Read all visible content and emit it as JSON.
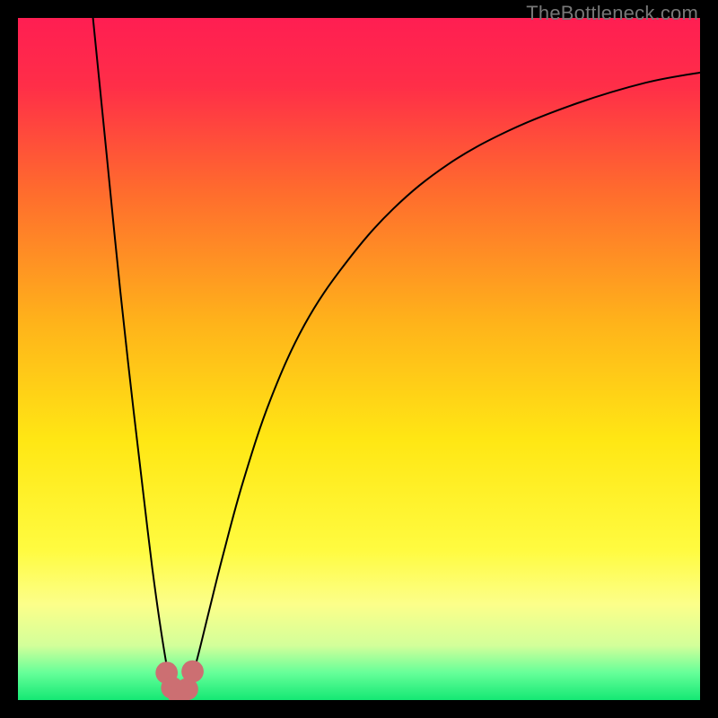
{
  "watermark": "TheBottleneck.com",
  "chart_data": {
    "type": "line",
    "title": "",
    "xlabel": "",
    "ylabel": "",
    "xlim": [
      0,
      100
    ],
    "ylim": [
      0,
      100
    ],
    "grid": false,
    "legend": false,
    "background": {
      "type": "vertical-gradient",
      "stops": [
        {
          "pos": 0.0,
          "color": "#ff1e52"
        },
        {
          "pos": 0.1,
          "color": "#ff2e48"
        },
        {
          "pos": 0.25,
          "color": "#ff6a2e"
        },
        {
          "pos": 0.45,
          "color": "#ffb41a"
        },
        {
          "pos": 0.62,
          "color": "#ffe714"
        },
        {
          "pos": 0.78,
          "color": "#fffb40"
        },
        {
          "pos": 0.86,
          "color": "#fcff8a"
        },
        {
          "pos": 0.92,
          "color": "#d3ff9a"
        },
        {
          "pos": 0.96,
          "color": "#66ff99"
        },
        {
          "pos": 1.0,
          "color": "#14e874"
        }
      ]
    },
    "series": [
      {
        "name": "left-branch",
        "style": "black-thin",
        "x": [
          11.0,
          13.0,
          15.0,
          17.0,
          19.0,
          20.0,
          21.0,
          22.0,
          22.8
        ],
        "y": [
          100.0,
          80.0,
          60.0,
          42.0,
          25.0,
          17.0,
          10.0,
          4.0,
          0.5
        ]
      },
      {
        "name": "right-branch",
        "style": "black-thin",
        "x": [
          24.5,
          26.0,
          28.0,
          30.0,
          33.0,
          37.0,
          42.0,
          48.0,
          55.0,
          63.0,
          72.0,
          82.0,
          92.0,
          100.0
        ],
        "y": [
          0.5,
          5.0,
          13.0,
          21.0,
          32.0,
          44.0,
          55.0,
          64.0,
          72.0,
          78.5,
          83.5,
          87.5,
          90.5,
          92.0
        ]
      }
    ],
    "markers": [
      {
        "name": "dot-a",
        "x": 21.8,
        "y": 4.0,
        "r": 1.4,
        "color": "#cc6f72"
      },
      {
        "name": "dot-b",
        "x": 22.6,
        "y": 1.8,
        "r": 1.4,
        "color": "#cc6f72"
      },
      {
        "name": "dot-c",
        "x": 23.6,
        "y": 0.8,
        "r": 1.4,
        "color": "#cc6f72"
      },
      {
        "name": "dot-d",
        "x": 24.8,
        "y": 1.6,
        "r": 1.4,
        "color": "#cc6f72"
      },
      {
        "name": "dot-e",
        "x": 25.6,
        "y": 4.2,
        "r": 1.4,
        "color": "#cc6f72"
      }
    ]
  }
}
